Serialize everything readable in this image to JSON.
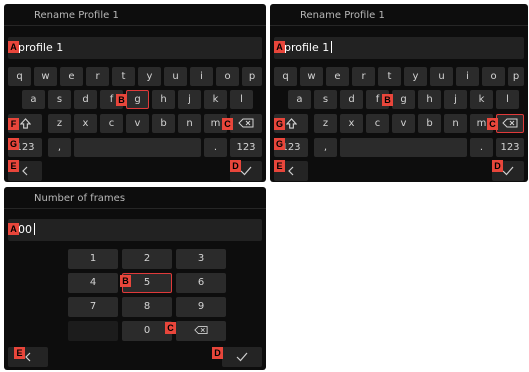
{
  "screens": [
    {
      "title": "Rename Profile 1",
      "input_value": "profile 1",
      "show_caret": false,
      "rows": [
        [
          "q",
          "w",
          "e",
          "r",
          "t",
          "y",
          "u",
          "i",
          "o",
          "p"
        ],
        [
          "a",
          "s",
          "d",
          "f",
          "g",
          "h",
          "j",
          "k",
          "l"
        ],
        [
          "z",
          "x",
          "c",
          "v",
          "b",
          "n",
          "m"
        ]
      ],
      "selected_key": "g",
      "bottom_keys": [
        ",",
        ".",
        "123"
      ],
      "abc_switch_label": "123",
      "markers": [
        "A",
        "B",
        "C",
        "D",
        "E",
        "F",
        "G"
      ]
    },
    {
      "title": "Rename Profile 1",
      "input_value": "profile 1",
      "show_caret": true,
      "rows": [
        [
          "q",
          "w",
          "e",
          "r",
          "t",
          "y",
          "u",
          "i",
          "o",
          "p"
        ],
        [
          "a",
          "s",
          "d",
          "f",
          "g",
          "h",
          "j",
          "k",
          "l"
        ],
        [
          "z",
          "x",
          "c",
          "v",
          "b",
          "n",
          "m"
        ]
      ],
      "selected_key": "backspace",
      "bottom_keys": [
        ",",
        ".",
        "123"
      ],
      "abc_switch_label": "123",
      "markers": [
        "A",
        "B",
        "C",
        "D",
        "E",
        "G"
      ]
    },
    {
      "title": "Number of frames",
      "input_value": "00",
      "show_caret": true,
      "numpad": [
        "1",
        "2",
        "3",
        "4",
        "5",
        "6",
        "7",
        "8",
        "9",
        "0"
      ],
      "selected_key": "5",
      "markers": [
        "A",
        "B",
        "C",
        "D",
        "E"
      ]
    }
  ],
  "icons": {
    "shift": "shift-arrow-icon",
    "backspace": "backspace-icon",
    "back": "chevron-left-icon",
    "confirm": "checkmark-icon"
  },
  "colors": {
    "marker": "#e8463b",
    "selection": "#e03a3a",
    "background": "#0d0d0d"
  }
}
